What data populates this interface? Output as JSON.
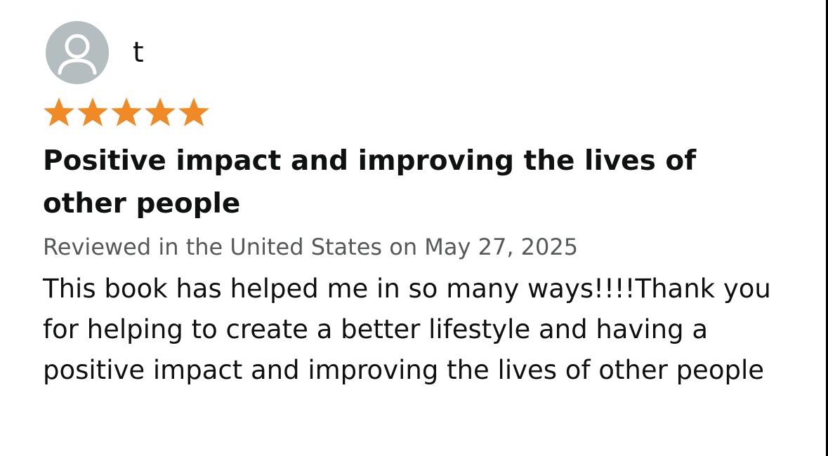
{
  "review": {
    "reviewer_name": "t",
    "avatar_icon": "user-avatar-icon",
    "rating": 5,
    "rating_max": 5,
    "star_color": "#f08a24",
    "title": "Positive impact and improving the lives of other people",
    "meta": "Reviewed in the United States on May 27, 2025",
    "body": "This book has helped me in so many ways!!!!Thank you for helping to create a better lifestyle and having a positive impact and improving the lives of other people"
  }
}
